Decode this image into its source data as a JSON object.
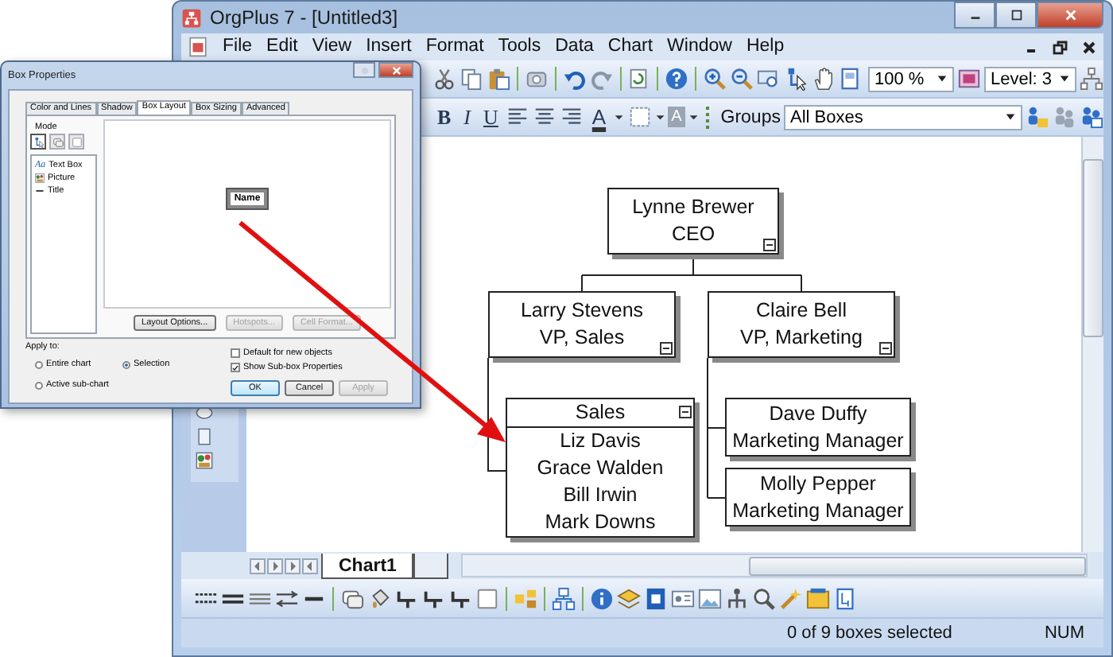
{
  "app": {
    "title": "OrgPlus 7 - [Untitled3]",
    "menu": [
      "File",
      "Edit",
      "View",
      "Insert",
      "Format",
      "Tools",
      "Data",
      "Chart",
      "Window",
      "Help"
    ],
    "zoom": "100 %",
    "level": "Level: 3",
    "format_buttons": [
      "B",
      "I",
      "U"
    ],
    "font_color_glyph": "A",
    "fill_glyph": "A",
    "groups_label": "Groups",
    "groups_value": "All Boxes"
  },
  "org_chart": {
    "name": "Lynne Brewer",
    "title": "CEO",
    "children": [
      {
        "name": "Larry Stevens",
        "title": "VP, Sales",
        "children": [
          {
            "title": "Sales",
            "members": [
              "Liz Davis",
              "Grace Walden",
              "Bill Irwin",
              "Mark Downs"
            ]
          }
        ]
      },
      {
        "name": "Claire Bell",
        "title": "VP, Marketing",
        "children": [
          {
            "name": "Dave Duffy",
            "title": "Marketing Manager"
          },
          {
            "name": "Molly Pepper",
            "title": "Marketing Manager"
          }
        ]
      }
    ]
  },
  "sheet_tabs": [
    {
      "label": "Chart1",
      "selected": true
    }
  ],
  "status_bar": {
    "message": "0 of 9 boxes selected",
    "indicator": "NUM"
  },
  "dialog": {
    "title": "Box Properties",
    "tabs": [
      {
        "label": "Color and Lines",
        "selected": false
      },
      {
        "label": "Shadow",
        "selected": false
      },
      {
        "label": "Box Layout",
        "selected": true
      },
      {
        "label": "Box Sizing",
        "selected": false
      },
      {
        "label": "Advanced",
        "selected": false
      }
    ],
    "mode_label": "Mode",
    "mode_buttons": [
      {
        "selected": true
      },
      {
        "selected": false
      },
      {
        "selected": false
      }
    ],
    "elements": [
      {
        "kind": "text",
        "icon_text": "Aa",
        "label": "Text Box"
      },
      {
        "kind": "picture",
        "label": "Picture"
      },
      {
        "kind": "title",
        "label": "Title"
      }
    ],
    "preview_box": "Name",
    "panel_buttons": [
      {
        "label": "Layout Options...",
        "disabled": false
      },
      {
        "label": "Hotspots...",
        "disabled": true
      },
      {
        "label": "Cell Format...",
        "disabled": true
      }
    ],
    "apply_to_label": "Apply to:",
    "apply_to": [
      {
        "label": "Entire chart",
        "selected": false
      },
      {
        "label": "Selection",
        "selected": true
      },
      {
        "label": "Active sub-chart",
        "selected": false
      }
    ],
    "checkboxes": [
      {
        "label": "Default for new objects",
        "checked": false
      },
      {
        "label": "Show Sub-box Properties",
        "checked": true
      }
    ],
    "buttons": [
      {
        "label": "OK",
        "disabled": false
      },
      {
        "label": "Cancel",
        "disabled": false
      },
      {
        "label": "Apply",
        "disabled": true
      }
    ]
  }
}
